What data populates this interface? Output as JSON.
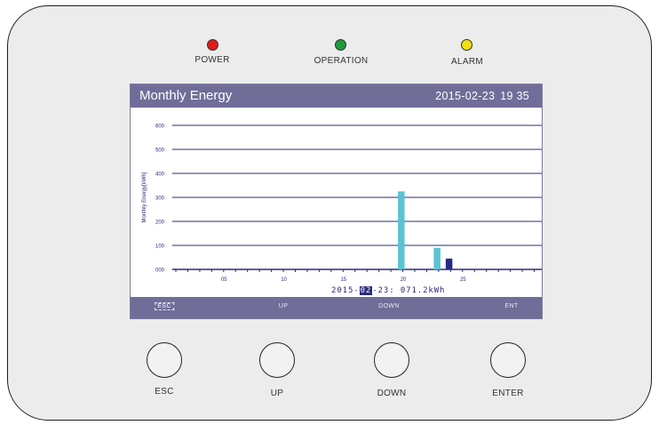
{
  "leds": [
    {
      "label": "POWER",
      "color": "#e01b1b"
    },
    {
      "label": "OPERATION",
      "color": "#1f9a3c"
    },
    {
      "label": "ALARM",
      "color": "#f2e010"
    }
  ],
  "screen": {
    "title": "Monthly Energy",
    "date": "2015-02-23",
    "time": "19 35",
    "readout": {
      "prefix": "2015-",
      "selected": "02",
      "suffix": "-23:  071.2kWh"
    },
    "softkeys": [
      "ESC",
      "UP",
      "DOWN",
      "ENT"
    ]
  },
  "chart_data": {
    "type": "bar",
    "title": "",
    "ylabel": "Monthly Energy[kWh]",
    "xlabel": "",
    "ylim": [
      0,
      600
    ],
    "xlim": [
      0,
      31
    ],
    "yticks": [
      "000",
      "100",
      "200",
      "300",
      "400",
      "500",
      "600"
    ],
    "xticks": [
      "05",
      "10",
      "15",
      "20",
      "25"
    ],
    "grid": true,
    "bars": [
      {
        "day": 20,
        "value": 325,
        "color": "#5bc4d0"
      },
      {
        "day": 23,
        "value": 90,
        "color": "#5bc4d0"
      },
      {
        "day": 24,
        "value": 45,
        "color": "#262a86"
      }
    ]
  },
  "buttons": [
    "ESC",
    "UP",
    "DOWN",
    "ENTER"
  ]
}
